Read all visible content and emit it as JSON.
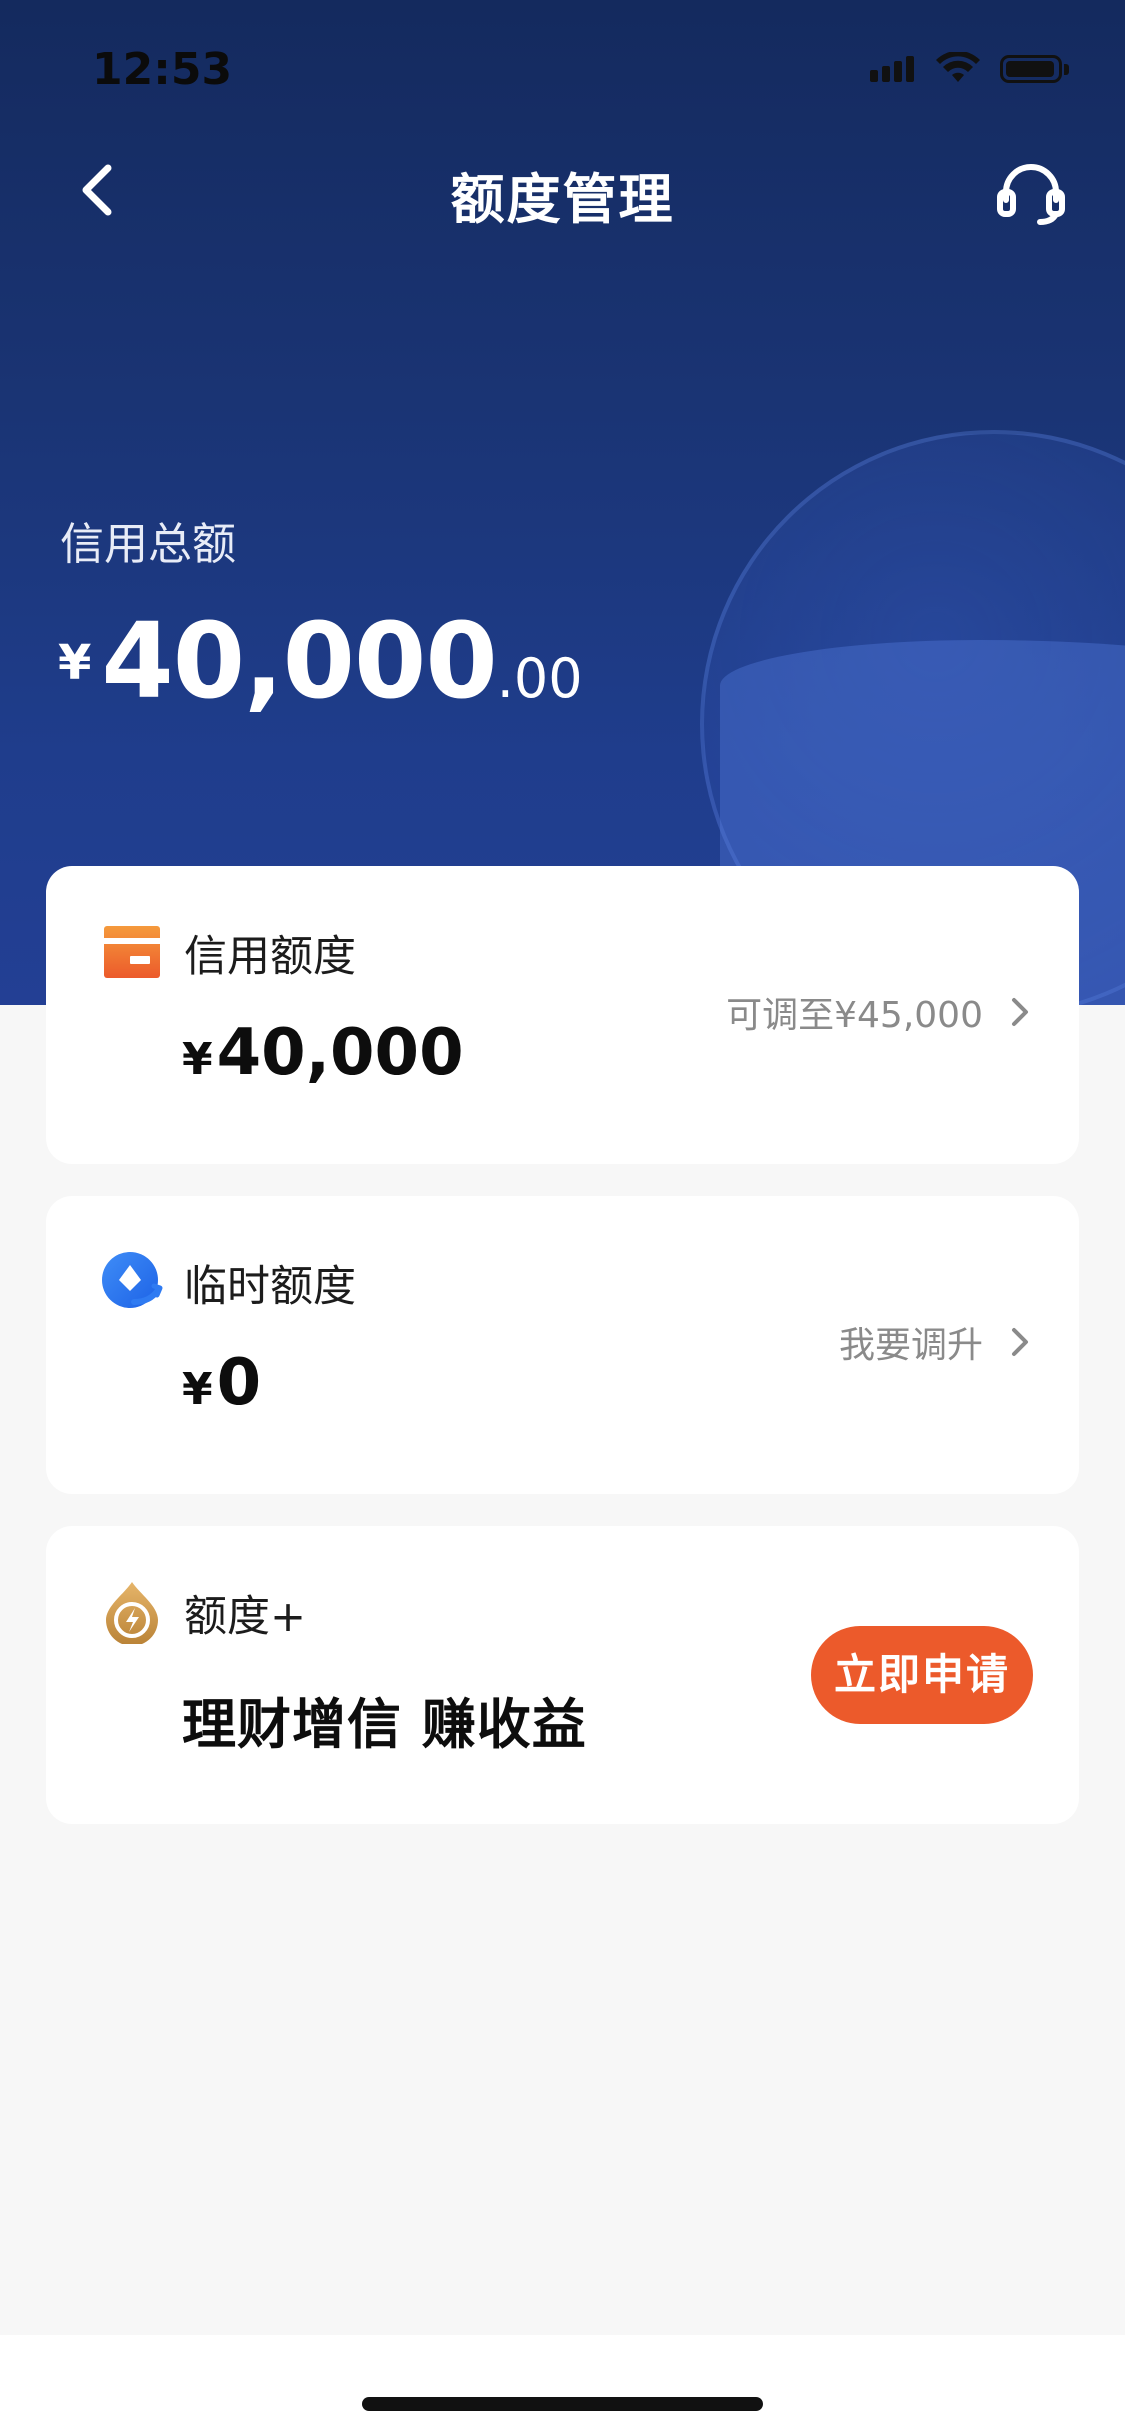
{
  "status_bar": {
    "time": "12:53"
  },
  "nav": {
    "title": "额度管理"
  },
  "summary": {
    "label": "信用总额",
    "currency": "¥",
    "amount_int": "40,000",
    "amount_dec": ".00"
  },
  "cards": [
    {
      "title": "信用额度",
      "currency": "¥",
      "amount": "40,000",
      "action": "可调至¥45,000"
    },
    {
      "title": "临时额度",
      "currency": "¥",
      "amount": "0",
      "action": "我要调升"
    },
    {
      "title": "额度+",
      "headline": "理财增信 赚收益",
      "button": "立即申请"
    }
  ],
  "colors": {
    "header_bg": "#1a3474",
    "accent_orange": "#ec5a2b",
    "card_bg": "#ffffff",
    "page_bg": "#f5f5f6"
  },
  "icons": [
    "back-arrow-icon",
    "headset-icon",
    "credit-card-icon",
    "temp-credit-icon",
    "bolt-drop-icon",
    "chevron-right-icon"
  ]
}
